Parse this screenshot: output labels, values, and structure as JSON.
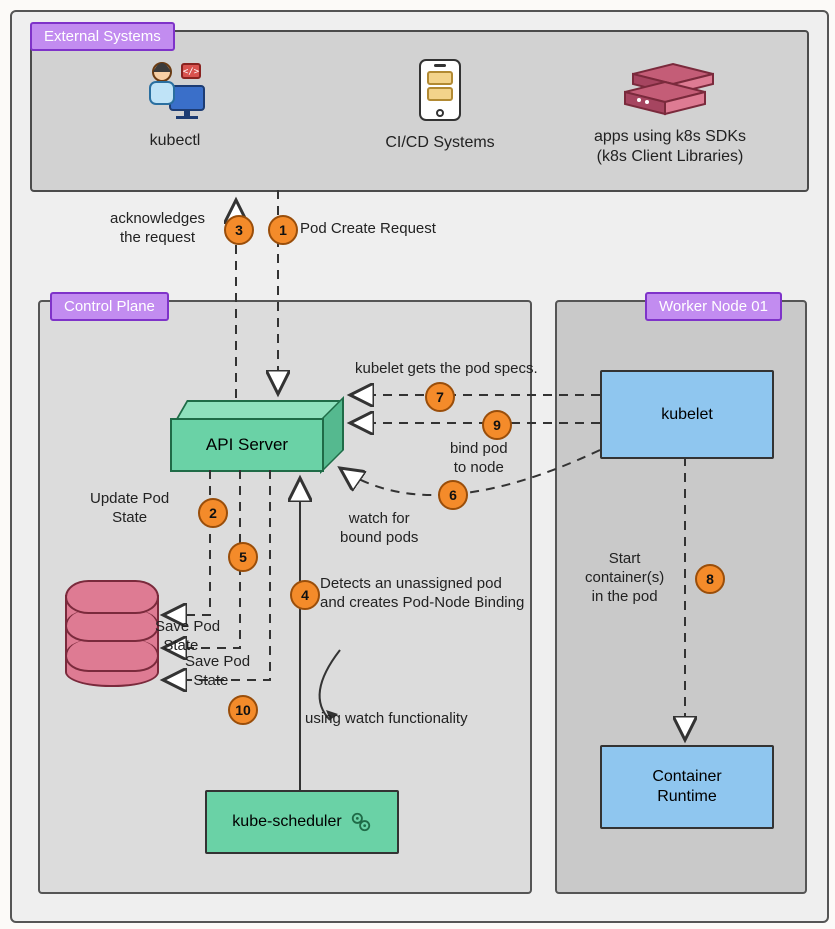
{
  "sections": {
    "external_systems": "External Systems",
    "control_plane": "Control Plane",
    "worker_node": "Worker Node 01"
  },
  "external": {
    "kubectl": "kubectl",
    "cicd": "CI/CD Systems",
    "apps_line1": "apps using k8s SDKs",
    "apps_line2": "(k8s Client Libraries)"
  },
  "components": {
    "api_server": "API Server",
    "kubelet": "kubelet",
    "container_runtime_l1": "Container",
    "container_runtime_l2": "Runtime",
    "kube_scheduler": "kube-scheduler"
  },
  "labels": {
    "pod_create_request": "Pod Create Request",
    "ack_l1": "acknowledges",
    "ack_l2": "the request",
    "update_pod_l1": "Update Pod",
    "update_pod_l2": "State",
    "save_pod_l1": "Save Pod",
    "save_pod_l2": "State",
    "save_pod2_l1": "Save Pod",
    "save_pod2_l2": "State",
    "detect_l1": "Detects an unassigned pod",
    "detect_l2": "and creates Pod-Node Binding",
    "watch_func": "using watch functionality",
    "watch_bound_l1": "watch for",
    "watch_bound_l2": "bound pods",
    "kubelet_specs": "kubelet gets the pod specs.",
    "start_container_l1": "Start",
    "start_container_l2": "container(s)",
    "start_container_l3": "in the pod",
    "bind_pod_l1": "bind pod",
    "bind_pod_l2": "to node"
  },
  "steps": {
    "s1": "1",
    "s2": "2",
    "s3": "3",
    "s4": "4",
    "s5": "5",
    "s6": "6",
    "s7": "7",
    "s8": "8",
    "s9": "9",
    "s10": "10"
  }
}
